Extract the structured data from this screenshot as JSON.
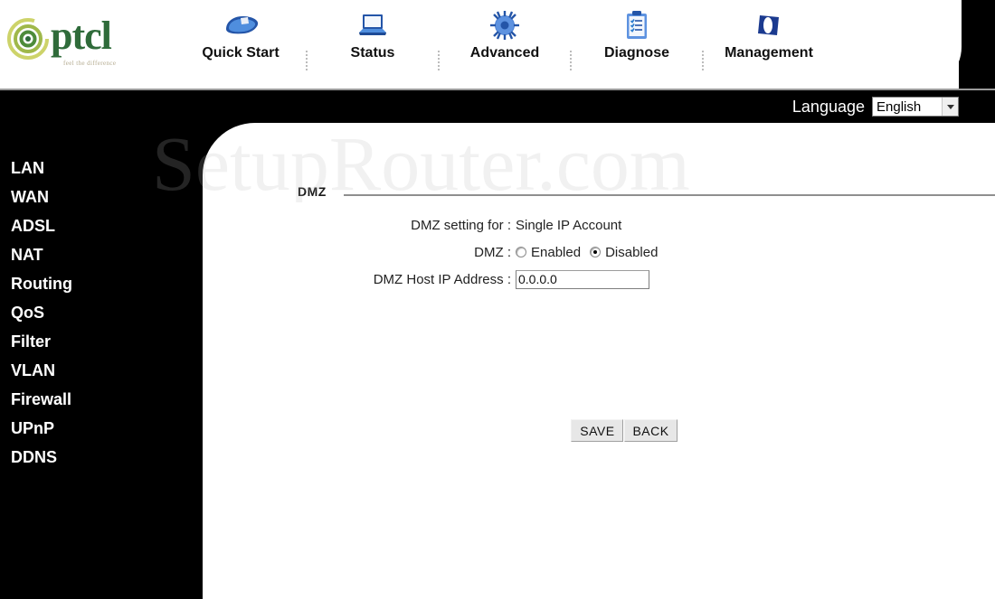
{
  "header": {
    "logo": {
      "brand": "ptcl",
      "tagline": "feel the difference",
      "icon": "ptcl-spiral-logo"
    },
    "nav": [
      {
        "label": "Quick Start",
        "icon": "mouse-icon"
      },
      {
        "label": "Status",
        "icon": "laptop-icon"
      },
      {
        "label": "Advanced",
        "icon": "gear-icon"
      },
      {
        "label": "Diagnose",
        "icon": "clipboard-icon"
      },
      {
        "label": "Management",
        "icon": "flag-icon"
      }
    ]
  },
  "language": {
    "label": "Language",
    "selected": "English",
    "options": [
      "English"
    ],
    "arrow_icon": "chevron-down-icon"
  },
  "sidebar": {
    "items": [
      {
        "label": "LAN"
      },
      {
        "label": "WAN"
      },
      {
        "label": "ADSL"
      },
      {
        "label": "NAT"
      },
      {
        "label": "Routing"
      },
      {
        "label": "QoS"
      },
      {
        "label": "Filter"
      },
      {
        "label": "VLAN"
      },
      {
        "label": "Firewall"
      },
      {
        "label": "UPnP"
      },
      {
        "label": "DDNS"
      }
    ]
  },
  "main": {
    "section_title": "DMZ",
    "fields": {
      "setting_for_label": "DMZ setting for :",
      "setting_for_value": "Single IP Account",
      "dmz_label": "DMZ :",
      "enabled_label": "Enabled",
      "disabled_label": "Disabled",
      "dmz_selected": "Disabled",
      "host_ip_label": "DMZ Host IP Address :",
      "host_ip_value": "0.0.0.0"
    },
    "buttons": {
      "save": "SAVE",
      "back": "BACK"
    }
  },
  "watermark": {
    "text": "SetupRouter.com"
  },
  "colors": {
    "brand_green": "#2f6b3a",
    "nav_icon_blue": "#2b5fb8",
    "background_black": "#000000",
    "panel_white": "#ffffff"
  }
}
